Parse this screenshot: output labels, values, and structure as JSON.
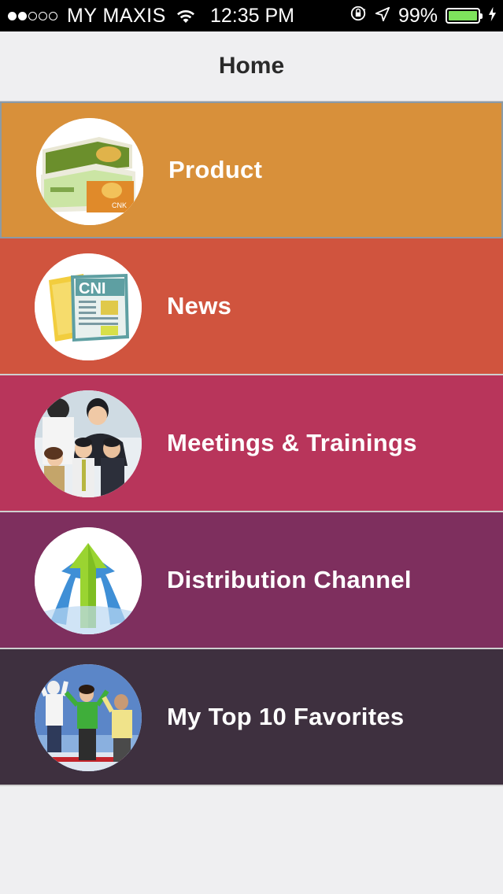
{
  "status_bar": {
    "carrier": "MY MAXIS",
    "time": "12:35 PM",
    "battery_percent": "99%",
    "battery_level": 0.99,
    "signal_bars": 2,
    "icons": [
      "wifi-icon",
      "rotation-lock-icon",
      "location-arrow-icon",
      "battery-icon",
      "charging-bolt-icon"
    ]
  },
  "nav": {
    "title": "Home"
  },
  "menu": {
    "items": [
      {
        "label": "Product",
        "color": "#d8903a",
        "icon": "product-boxes-icon"
      },
      {
        "label": "News",
        "color": "#d0543e",
        "icon": "newspaper-icon"
      },
      {
        "label": "Meetings & Trainings",
        "color": "#b8355b",
        "icon": "business-people-icon"
      },
      {
        "label": "Distribution Channel",
        "color": "#7e2f5e",
        "icon": "growth-arrows-icon"
      },
      {
        "label": "My Top 10 Favorites",
        "color": "#3e303f",
        "icon": "jumping-people-icon"
      }
    ]
  },
  "colors": {
    "status_bar_bg": "#000000",
    "nav_bg": "#efeff1",
    "battery_fill": "#7ee35d"
  }
}
